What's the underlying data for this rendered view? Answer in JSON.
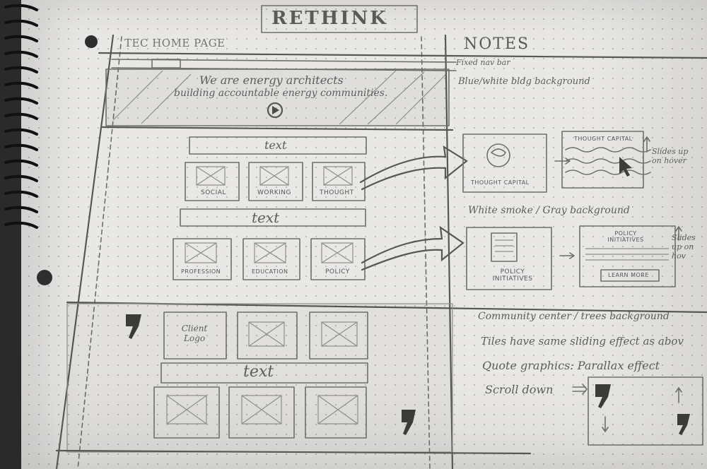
{
  "sketch": {
    "title": "RETHINK",
    "page_label": "TEC HOME PAGE",
    "notes_heading": "NOTES",
    "hero": {
      "line1": "We are energy architects",
      "line2": "building accountable energy communities."
    },
    "section_text_1": "text",
    "section_text_2": "text",
    "section_text_3": "text",
    "tiles_row1": [
      "SOCIAL",
      "WORKING",
      "THOUGHT"
    ],
    "tiles_row2": [
      "PROFESSION",
      "EDUCATION",
      "POLICY"
    ],
    "client_logo": "Client Logo",
    "detail_cards": {
      "thought_capital": "THOUGHT CAPITAL",
      "thought_capital_header": "THOUGHT CAPITAL",
      "policy_initiatives": "POLICY INITIATIVES",
      "policy_initiatives_header": "POLICY INITIATIVES",
      "learn_more": "LEARN MORE"
    },
    "notes": {
      "fixed_nav": "Fixed nav bar",
      "hero_bg": "Blue/white bldg background",
      "slides_up_1": "Slides up on hover",
      "slides_up_2": "Slides up on hov",
      "white_smoke": "White smoke / Gray background",
      "community": "Community center / trees background",
      "tiles_effect": "Tiles have same sliding effect as abov",
      "quote_graphics": "Quote graphics: Parallax effect",
      "scroll_down": "Scroll down"
    }
  }
}
